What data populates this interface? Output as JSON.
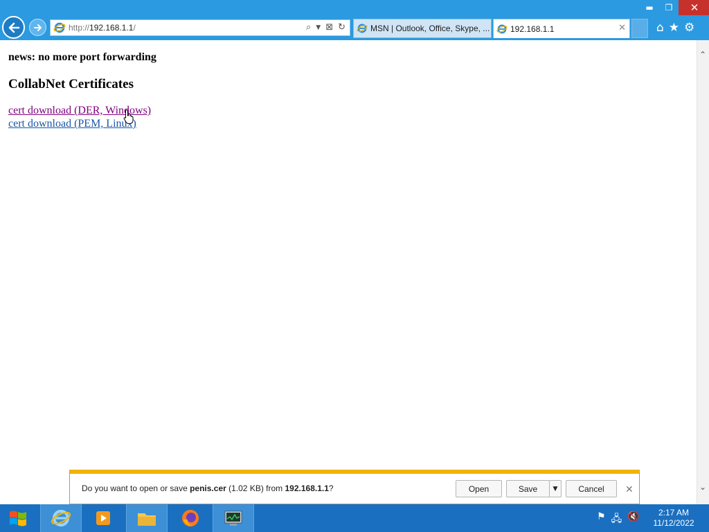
{
  "window": {
    "minimize": "▬",
    "restore": "❐",
    "close": "✕"
  },
  "address_bar": {
    "url_prefix": "http://",
    "url_host": "192.168.1.1",
    "url_suffix": "/"
  },
  "tabs": [
    {
      "label": "MSN | Outlook, Office, Skype, ...",
      "active": false
    },
    {
      "label": "192.168.1.1",
      "active": true
    }
  ],
  "page": {
    "news": "news: no more port forwarding",
    "heading": "CollabNet Certificates",
    "links": [
      {
        "label": "cert download (DER, Windows)",
        "visited": true
      },
      {
        "label": "cert download (PEM, Linux)",
        "visited": false
      }
    ]
  },
  "notification": {
    "text_before": "Do you want to open or save ",
    "file_name": "penis.cer",
    "size": " (1.02 KB) from ",
    "host": "192.168.1.1",
    "text_after": "?",
    "open_label": "Open",
    "save_label": "Save",
    "cancel_label": "Cancel"
  },
  "taskbar": {
    "items": [
      "start-button",
      "internet-explorer",
      "media-player",
      "file-explorer",
      "firefox",
      "task-manager"
    ],
    "clock_time": "2:17 AM",
    "clock_date": "11/12/2022"
  },
  "colors": {
    "title_bar": "#2b9ae0",
    "taskbar": "#1b6fc0",
    "visited_link": "#800080",
    "link": "#1a56a6",
    "notification_accent": "#f1b300"
  }
}
